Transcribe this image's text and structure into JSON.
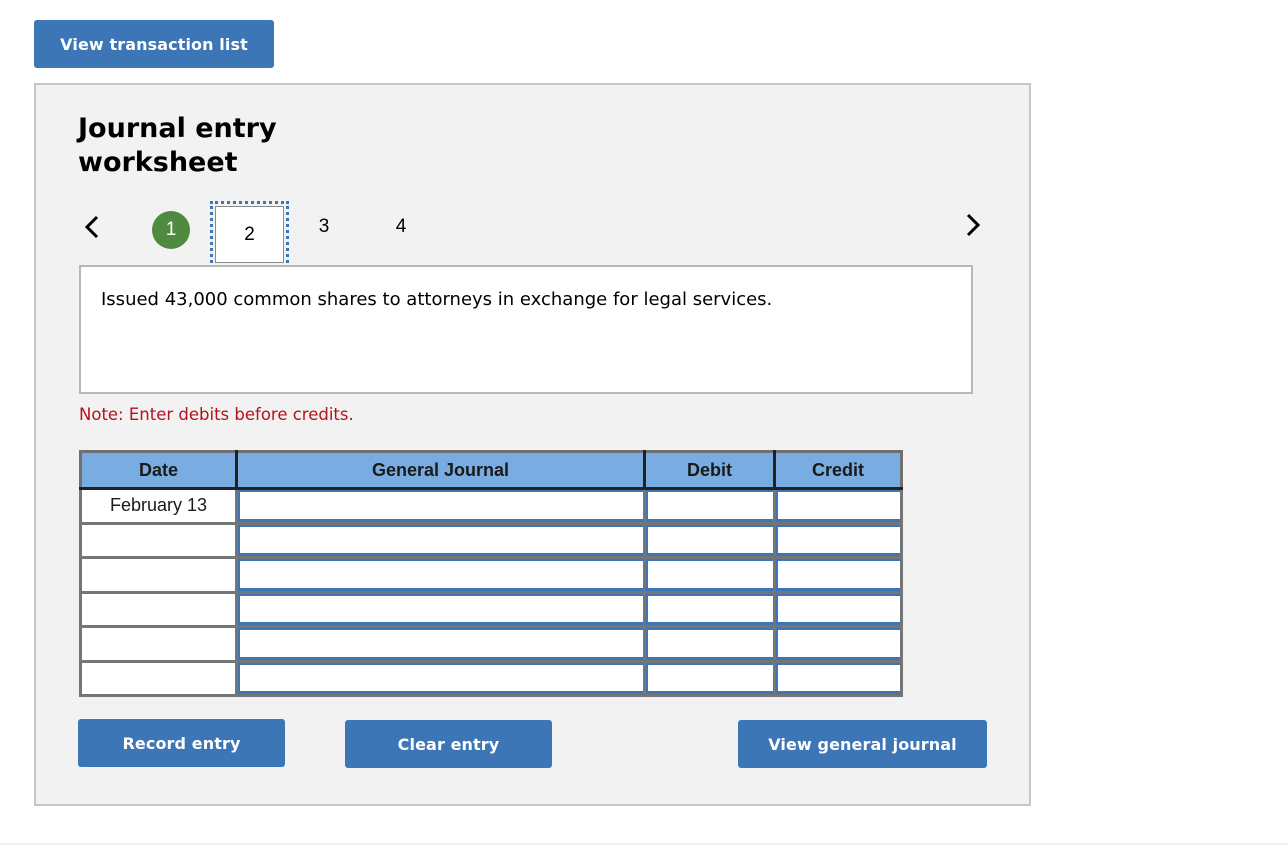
{
  "toolbar": {
    "view_transactions_label": "View transaction list"
  },
  "worksheet": {
    "title": "Journal entry worksheet",
    "pager": {
      "prev_icon": "chevron-left-icon",
      "next_icon": "chevron-right-icon",
      "steps": [
        {
          "label": "1",
          "state": "completed"
        },
        {
          "label": "2",
          "state": "current"
        },
        {
          "label": "3",
          "state": "pending"
        },
        {
          "label": "4",
          "state": "pending"
        }
      ]
    },
    "description": "Issued 43,000 common shares to attorneys in exchange for legal services.",
    "note": "Note: Enter debits before credits."
  },
  "journal_table": {
    "columns": [
      "Date",
      "General Journal",
      "Debit",
      "Credit"
    ],
    "rows": [
      {
        "date": "February 13",
        "account": "",
        "debit": "",
        "credit": ""
      },
      {
        "date": "",
        "account": "",
        "debit": "",
        "credit": ""
      },
      {
        "date": "",
        "account": "",
        "debit": "",
        "credit": ""
      },
      {
        "date": "",
        "account": "",
        "debit": "",
        "credit": ""
      },
      {
        "date": "",
        "account": "",
        "debit": "",
        "credit": ""
      },
      {
        "date": "",
        "account": "",
        "debit": "",
        "credit": ""
      }
    ]
  },
  "actions": {
    "record_label": "Record entry",
    "clear_label": "Clear entry",
    "view_general_journal_label": "View general journal"
  },
  "colors": {
    "button": "#3d76b7",
    "completed_step": "#4e8a3f",
    "note_text": "#b5121b",
    "table_header": "#79ade2",
    "panel_bg": "#f2f2f2"
  }
}
